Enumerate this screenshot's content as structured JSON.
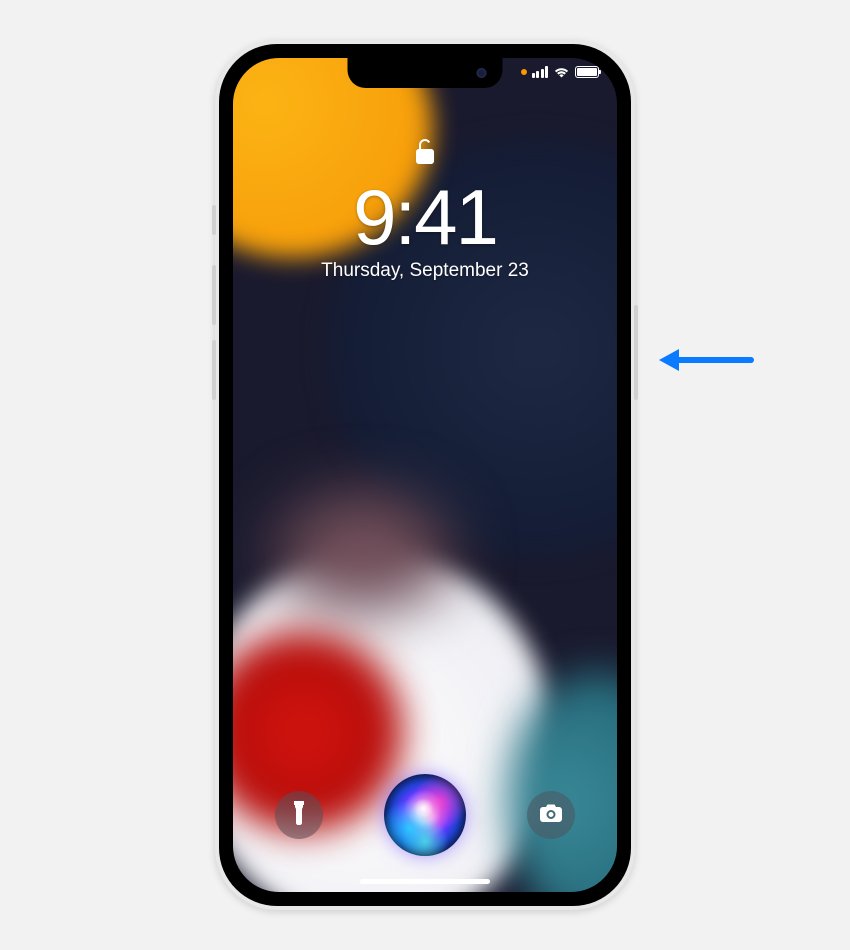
{
  "lockscreen": {
    "time": "9:41",
    "date": "Thursday, September 23",
    "lock_state": "unlocked"
  },
  "status": {
    "location_active": true,
    "battery_pct": 100
  },
  "annotation": {
    "arrow_target": "side-button"
  },
  "icons": {
    "flashlight": "flashlight-icon",
    "camera": "camera-icon",
    "siri": "siri-orb",
    "lock": "unlock-icon",
    "wifi": "wifi-icon",
    "cell": "cell-signal-icon",
    "battery": "battery-icon"
  }
}
